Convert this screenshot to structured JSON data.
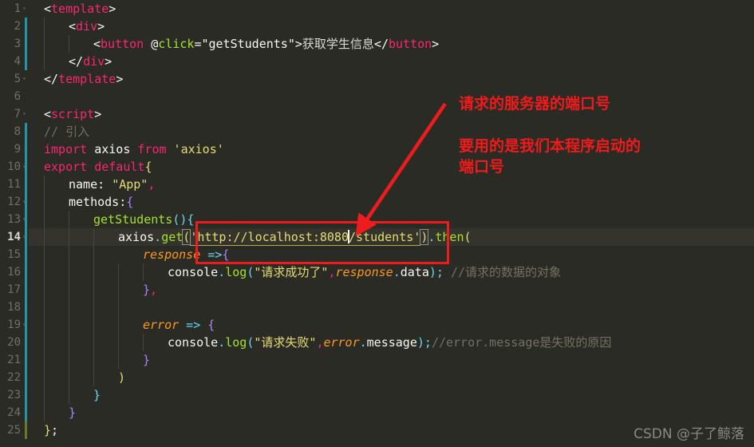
{
  "editor": {
    "language": "vue",
    "theme": "monokai-dark",
    "background": "#2b2b26",
    "active_line": 14,
    "total_lines": 25,
    "line_numbers": [
      "1",
      "2",
      "3",
      "4",
      "5",
      "6",
      "7",
      "8",
      "9",
      "10",
      "11",
      "12",
      "13",
      "14",
      "15",
      "16",
      "17",
      "18",
      "19",
      "20",
      "21",
      "22",
      "23",
      "24",
      "25"
    ],
    "gutter": {
      "modified_bar_color": "#2196a6",
      "added_bar_color": "#6b7a28"
    }
  },
  "code": {
    "lines": [
      {
        "n": "1",
        "text": "<template>"
      },
      {
        "n": "2",
        "text": "    <div>"
      },
      {
        "n": "3",
        "text": "        <button @click=\"getStudents\">获取学生信息</button>"
      },
      {
        "n": "4",
        "text": "    </div>"
      },
      {
        "n": "5",
        "text": "</template>"
      },
      {
        "n": "6",
        "text": ""
      },
      {
        "n": "7",
        "text": "<script>"
      },
      {
        "n": "8",
        "text": "// 引入"
      },
      {
        "n": "9",
        "text": "import axios from 'axios'"
      },
      {
        "n": "10",
        "text": "export default{"
      },
      {
        "n": "11",
        "text": "    name: \"App\","
      },
      {
        "n": "12",
        "text": "    methods:{"
      },
      {
        "n": "13",
        "text": "        getStudents(){"
      },
      {
        "n": "14",
        "text": "            axios.get('http://localhost:8080/students').then("
      },
      {
        "n": "15",
        "text": "                response =>{"
      },
      {
        "n": "16",
        "text": "                    console.log(\"请求成功了\",response.data); //请求的数据的对象"
      },
      {
        "n": "17",
        "text": "                },"
      },
      {
        "n": "18",
        "text": ""
      },
      {
        "n": "19",
        "text": "                error => {"
      },
      {
        "n": "20",
        "text": "                    console.log(\"请求失败\",error.message);//error.message是失败的原因"
      },
      {
        "n": "21",
        "text": "                }"
      },
      {
        "n": "22",
        "text": "            )"
      },
      {
        "n": "23",
        "text": "        }"
      },
      {
        "n": "24",
        "text": "    }"
      },
      {
        "n": "25",
        "text": "};"
      }
    ],
    "tokens": {
      "l1_open": "<",
      "l1_tag": "template",
      "l1_close": ">",
      "l2_open": "<",
      "l2_tag": "div",
      "l2_close": ">",
      "l3_open": "<",
      "l3_tag": "button",
      "l3_space": " ",
      "l3_at": "@",
      "l3_attr": "click",
      "l3_eq": "=",
      "l3_val": "\"getStudents\"",
      "l3_gt": ">",
      "l3_cn": "获取学生信息",
      "l3_endopen": "</",
      "l3_endtag": "button",
      "l3_endclose": ">",
      "l4_open": "</",
      "l4_tag": "div",
      "l4_close": ">",
      "l5_open": "</",
      "l5_tag": "template",
      "l5_close": ">",
      "l7_open": "<",
      "l7_tag": "script",
      "l7_close": ">",
      "l8_comment": "// 引入",
      "l9_import": "import",
      "l9_name": " axios ",
      "l9_from": "from",
      "l9_mod": " 'axios'",
      "l10_export": "export",
      "l10_default": " default",
      "l10_brace": "{",
      "l11_key": "name: ",
      "l11_str": "\"App\"",
      "l11_comma": ",",
      "l12_key": "methods:",
      "l12_brace": "{",
      "l13_fn": "getStudents",
      "l13_paren": "()",
      "l13_brace": "{",
      "l14_obj": "axios",
      "l14_dot": ".",
      "l14_method": "get",
      "l14_open": "(",
      "l14_url_a": "'http://localhost:8080",
      "l14_url_b": "/students'",
      "l14_closeparen": ")",
      "l14_dot2": ".",
      "l14_then": "then",
      "l14_open2": "(",
      "l15_param": "response",
      "l15_arrow": " =>",
      "l15_brace": "{",
      "l16_console": "console",
      "l16_dot": ".",
      "l16_log": "log",
      "l16_open": "(",
      "l16_str": "\"请求成功了\"",
      "l16_comma": ",",
      "l16_param": "response",
      "l16_dot2": ".",
      "l16_prop": "data",
      "l16_close": ")",
      "l16_semi": ";",
      "l16_comment": " //请求的数据的对象",
      "l17_brace": "}",
      "l17_comma": ",",
      "l19_param": "error",
      "l19_arrow": " => ",
      "l19_brace": "{",
      "l20_console": "console",
      "l20_dot": ".",
      "l20_log": "log",
      "l20_open": "(",
      "l20_str": "\"请求失败\"",
      "l20_comma": ",",
      "l20_param": "error",
      "l20_dot2": ".",
      "l20_prop": "message",
      "l20_close": ")",
      "l20_semi": ";",
      "l20_comment": "//error.message是失败的原因",
      "l21_brace": "}",
      "l22_paren": ")",
      "l23_brace": "}",
      "l24_brace": "}",
      "l25_brace": "}",
      "l25_semi": ";"
    }
  },
  "annotations": {
    "red_box": {
      "target_line": 14,
      "target_text": "'http://localhost:8080/students'",
      "color": "#ee1c1c"
    },
    "arrow": {
      "color": "#ee1c1c",
      "points_to": "8080"
    },
    "note_1": "请求的服务器的端口号",
    "note_2": "要用的是我们本程序启动的\n端口号"
  },
  "watermark": {
    "text": "CSDN @子了鲸落"
  }
}
